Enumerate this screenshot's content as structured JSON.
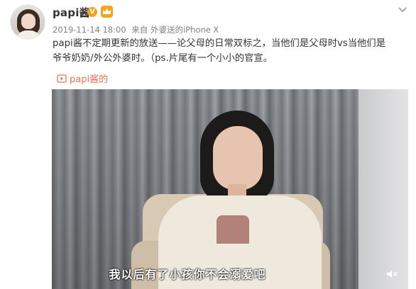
{
  "post": {
    "author": "papi酱",
    "verified_badge": "V",
    "timestamp": "2019-11-14 18:00",
    "source_prefix": "来自",
    "source": "外婆送的iPhone X",
    "text_line1": "papi酱不定期更新的放送——论父母的日常双标之，当他们是父母时vs当他们是",
    "text_line2": "爷爷奶奶/外公外婆时。（ps.片尾有一个小小的官宣。",
    "video_link": "papi酱的",
    "video_subtitle": "我以后有了小孩你不会溺爱吧"
  },
  "icons": {
    "verified": "v-badge-icon",
    "member": "crown-icon",
    "menu": "chevron-down-icon",
    "video": "video-play-icon",
    "mute": "mute-icon"
  },
  "colors": {
    "link": "#eb7350",
    "badge": "#f6a21c",
    "meta": "#808080"
  }
}
